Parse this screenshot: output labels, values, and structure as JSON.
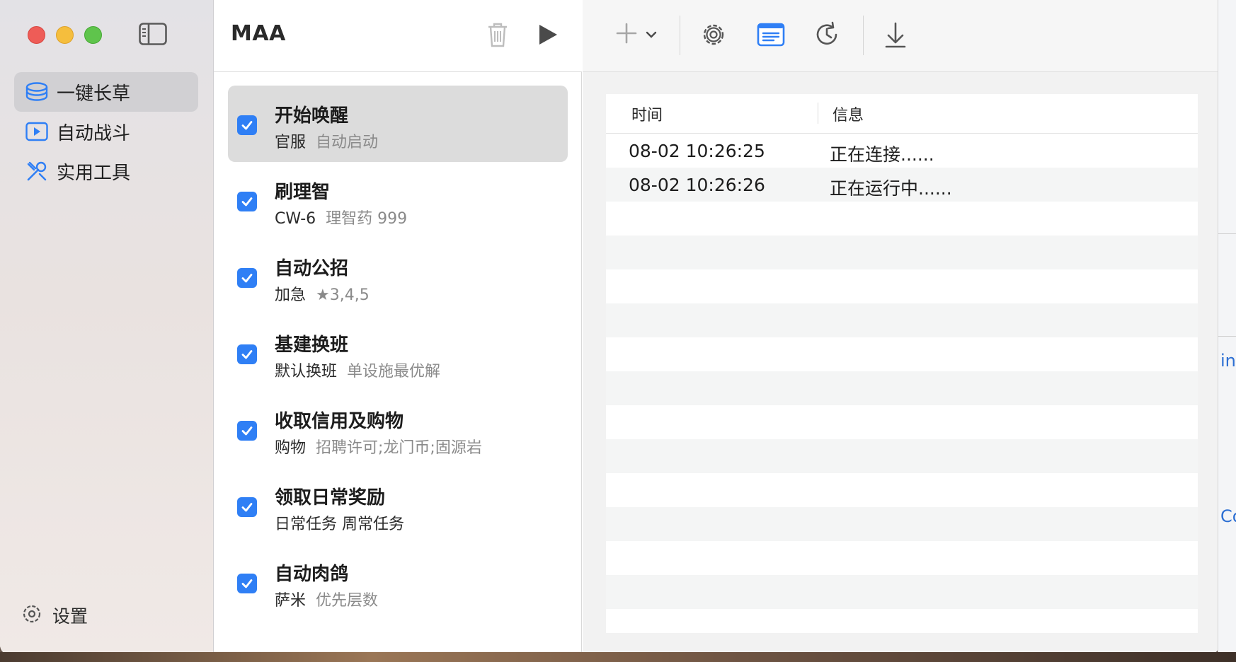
{
  "window": {
    "title": "MAA"
  },
  "sidebar": {
    "items": [
      {
        "label": "一键长草",
        "icon": "stack-icon",
        "active": true
      },
      {
        "label": "自动战斗",
        "icon": "play-rect-icon",
        "active": false
      },
      {
        "label": "实用工具",
        "icon": "tools-icon",
        "active": false
      }
    ],
    "settings_label": "设置"
  },
  "tasks": [
    {
      "title": "开始唤醒",
      "detail": "官服",
      "extra": "自动启动",
      "checked": true,
      "active": true
    },
    {
      "title": "刷理智",
      "detail": "CW-6",
      "extra": "理智药 999",
      "checked": true
    },
    {
      "title": "自动公招",
      "detail": "加急",
      "extra": "★3,4,5",
      "checked": true
    },
    {
      "title": "基建换班",
      "detail": "默认换班",
      "extra": "单设施最优解",
      "checked": true
    },
    {
      "title": "收取信用及购物",
      "detail": "购物",
      "extra": "招聘许可;龙门币;固源岩",
      "checked": true
    },
    {
      "title": "领取日常奖励",
      "detail": "日常任务 周常任务",
      "extra": "",
      "checked": true
    },
    {
      "title": "自动肉鸽",
      "detail": "萨米",
      "extra": "优先层数",
      "checked": true
    }
  ],
  "log": {
    "headers": {
      "time": "时间",
      "info": "信息"
    },
    "rows": [
      {
        "time": "08-02 10:26:25",
        "info": "正在连接......"
      },
      {
        "time": "08-02 10:26:26",
        "info": "正在运行中......"
      }
    ]
  },
  "desktop_fragments": [
    "ine",
    "Co"
  ],
  "colors": {
    "accent": "#2f7ff5",
    "sidebar_active": "#d1d0d3",
    "task_active": "#dcdcdc"
  }
}
